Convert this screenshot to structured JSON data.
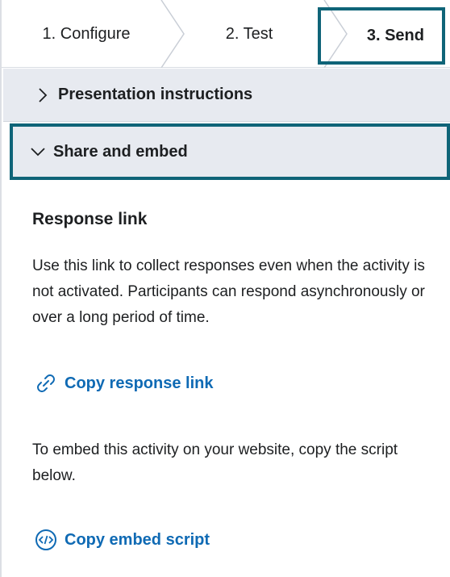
{
  "steps": {
    "configure_label": "1. Configure",
    "test_label": "2. Test",
    "send_label": "3. Send"
  },
  "accordion": {
    "presentation_label": "Presentation instructions",
    "share_label": "Share and embed"
  },
  "response_link": {
    "title": "Response link",
    "description": "Use this link to collect responses even when the activity is not activated. Participants can respond asynchronously or over a long period of time.",
    "copy_link_label": "Copy response link"
  },
  "embed": {
    "description": "To embed this activity on your website, copy the script below.",
    "copy_script_label": "Copy embed script"
  },
  "icons": {
    "link": "link-icon",
    "embed": "code-embed-icon",
    "collapsed": "chevron-right-icon",
    "expanded": "chevron-down-icon"
  },
  "colors": {
    "accent_border": "#0f6478",
    "link_blue": "#0f6ab4",
    "accordion_bg": "#e7eaf0"
  }
}
